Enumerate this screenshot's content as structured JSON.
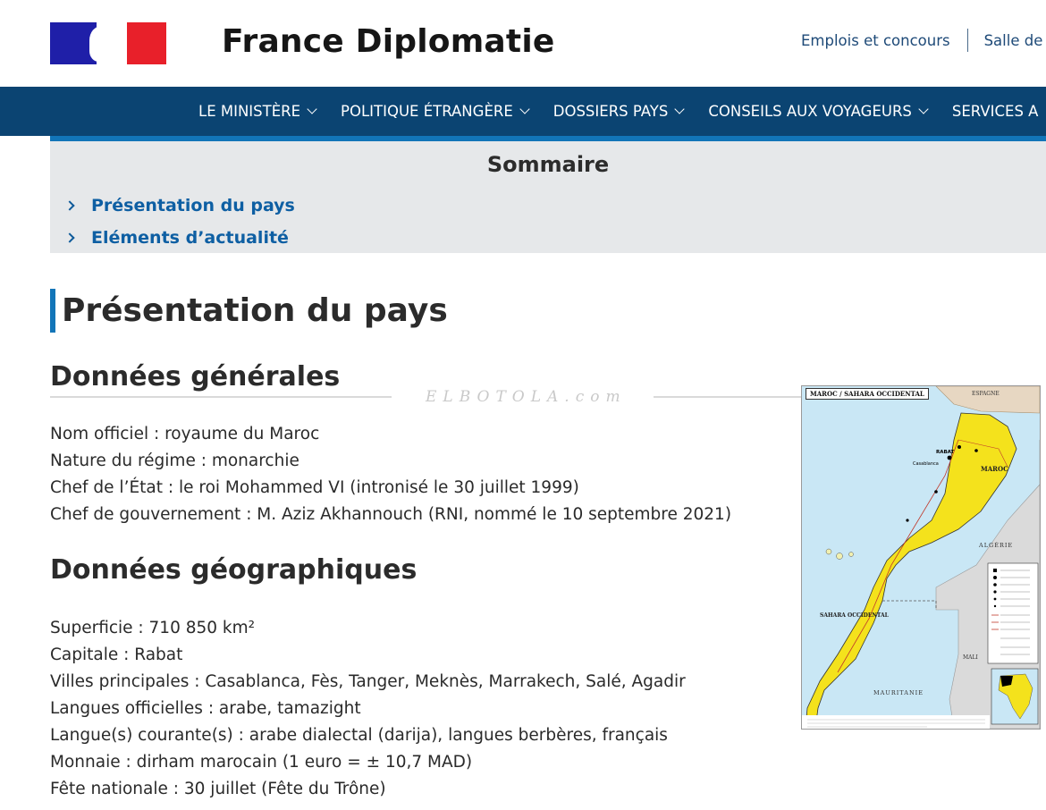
{
  "header": {
    "site_title": "France Diplomatie",
    "links": [
      "Emplois et concours",
      "Salle de"
    ]
  },
  "nav": {
    "items": [
      "LE MINISTÈRE",
      "POLITIQUE ÉTRANGÈRE",
      "DOSSIERS PAYS",
      "CONSEILS AUX VOYAGEURS",
      "SERVICES A"
    ]
  },
  "sommaire": {
    "title": "Sommaire",
    "links": [
      "Présentation du pays",
      "Eléments d’actualité"
    ]
  },
  "main": {
    "section_title": "Présentation du pays",
    "donnees_generales": {
      "title": "Données générales",
      "items": [
        "Nom officiel : royaume du Maroc",
        "Nature du régime : monarchie",
        "Chef de l’État : le roi Mohammed VI (intronisé le 30 juillet 1999)",
        "Chef de gouvernement : M. Aziz Akhannouch (RNI, nommé le 10 septembre 2021)"
      ]
    },
    "donnees_geographiques": {
      "title": "Données géographiques",
      "items": [
        "Superficie : 710 850 km²",
        "Capitale : Rabat",
        "Villes principales : Casablanca, Fès, Tanger, Meknès, Marrakech, Salé, Agadir",
        "Langues officielles : arabe, tamazight",
        "Langue(s) courante(s) : arabe dialectal (darija), langues berbères, français",
        "Monnaie : dirham marocain (1 euro = ± 10,7 MAD)",
        "Fête nationale : 30 juillet (Fête du Trône)"
      ]
    }
  },
  "watermark": "ELBOTOLA.com",
  "map": {
    "title": "MAROC / SAHARA OCCIDENTAL",
    "labels": [
      "MAROC",
      "SAHARA OCCIDENTAL",
      "ALGÉRIE",
      "MAURITANIE",
      "MALI",
      "ESPAGNE",
      "RABAT",
      "Casablanca"
    ]
  },
  "colors": {
    "nav_bg": "#0b4472",
    "accent_blue": "#1275b8",
    "link_blue": "#0e5fa3",
    "sommaire_bg": "#e6e8ea",
    "map_morocco": "#f4e21c"
  }
}
